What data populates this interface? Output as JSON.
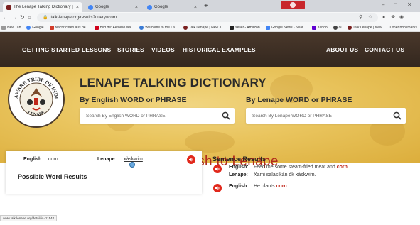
{
  "browser": {
    "tabs": [
      {
        "label": "The Lenape Talking Dictionary | C",
        "close": "×",
        "color": "#7a2020"
      },
      {
        "label": "Google",
        "close": "×",
        "color": "#4285f4"
      },
      {
        "label": "Google",
        "close": "×",
        "color": "#4285f4"
      }
    ],
    "new_tab": "+",
    "address": "talk-lenape.org/results?query=corn",
    "bookmarks": [
      {
        "label": "New Tab",
        "color": "#999999"
      },
      {
        "label": "Google",
        "color": "#4285f4"
      },
      {
        "label": "Nachrichten aus de...",
        "color": "#d23c2a"
      },
      {
        "label": "Bild.de: Aktuelle Na...",
        "color": "#d0021b"
      },
      {
        "label": "Welcome to the La...",
        "color": "#3a7bd5"
      },
      {
        "label": "Talk Lenape | New J...",
        "color": "#7a2020"
      },
      {
        "label": "seller - Amazon",
        "color": "#222222"
      },
      {
        "label": "Google News - Sear...",
        "color": "#4285f4"
      },
      {
        "label": "Yahoo",
        "color": "#6001d2"
      },
      {
        "label": "ol",
        "color": "#444444"
      },
      {
        "label": "Talk Lenape | New",
        "color": "#7a2020"
      }
    ],
    "other_bookmarks": "Other bookmarks",
    "status_url": "www.talk-lenape.org/detail/id=11544"
  },
  "nav": {
    "items": [
      "GETTING STARTED",
      "LESSONS",
      "STORIES",
      "VIDEOS",
      "HISTORICAL EXAMPLES",
      "ABOUT US",
      "CONTACT US"
    ]
  },
  "hero": {
    "title": "LENAPE TALKING DICTIONARY",
    "seal_top": "DELAWARE TRIBE OF INDIANS",
    "seal_bottom": "LENAPE",
    "english_label": "By English WORD or PHRASE",
    "english_placeholder": "Search By English WORD or PHRASE",
    "lenape_label": "By Lenape WORD or PHRASE",
    "lenape_placeholder": "Search By Lenape WORD or PHRASE"
  },
  "results": {
    "heading": "Search Results of \"corn\" English to Lenape",
    "english_label": "English:",
    "english_value": "corn",
    "lenape_label": "Lenape:",
    "lenape_value": "xàskwim",
    "possible_title": "Possible Word Results"
  },
  "sentences": {
    "title": "Sentence Results",
    "items": [
      {
        "en_label": "English:",
        "en_before": "Feed me some steam-fried meat and ",
        "en_hl": "corn",
        "en_after": ".",
        "le_label": "Lenape:",
        "le_value": "Xami salasìkàn òk xàskwim."
      },
      {
        "en_label": "English:",
        "en_before": "He plants ",
        "en_hl": "corn",
        "en_after": "."
      }
    ]
  },
  "colors": {
    "accent": "#b02a1c",
    "speaker": "#e1281b",
    "nav_bg": "#3d2f24",
    "hero_bg": "#e9c45d"
  },
  "icons": {
    "search": "magnifier-icon",
    "speaker": "speaker-icon"
  }
}
